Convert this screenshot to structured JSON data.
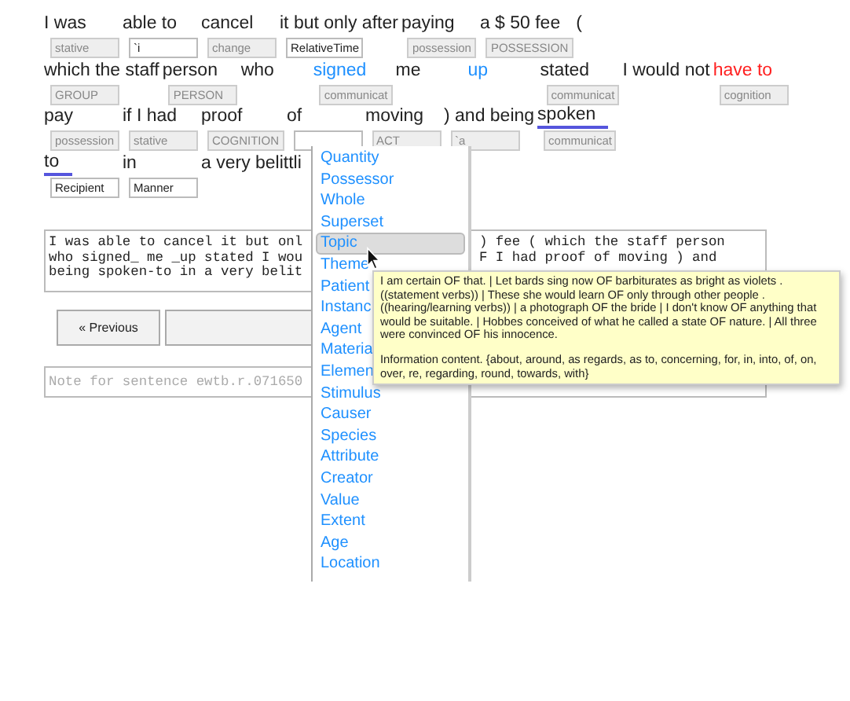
{
  "sentence_rows": [
    {
      "words": [
        {
          "text": "I was",
          "color": "#222222",
          "underlined": false,
          "tag": {
            "kind": "suggestion",
            "placeholder": "stative"
          }
        },
        {
          "text": "able to",
          "color": "#222222",
          "underlined": false,
          "tag": {
            "kind": "entered",
            "value": "`i"
          }
        },
        {
          "text": "cancel",
          "color": "#222222",
          "underlined": false,
          "tag": {
            "kind": "suggestion",
            "placeholder": "change"
          }
        },
        {
          "text": "it but only after",
          "color": "#222222",
          "underlined": false,
          "tag": {
            "kind": "entered",
            "value": "RelativeTime"
          }
        },
        {
          "text": "paying",
          "color": "#222222",
          "underlined": false,
          "tag": {
            "kind": "suggestion",
            "placeholder": "possession"
          }
        },
        {
          "text": "a $ 50 fee",
          "color": "#222222",
          "underlined": false,
          "tag": {
            "kind": "suggestion",
            "placeholder": "POSSESSION"
          }
        },
        {
          "text": "(",
          "color": "#222222",
          "underlined": false
        }
      ]
    },
    {
      "words": [
        {
          "text": "which the staff",
          "color": "#222222",
          "underlined": false,
          "tag": {
            "kind": "suggestion",
            "placeholder": "GROUP"
          }
        },
        {
          "text": "person",
          "color": "#222222",
          "underlined": false,
          "tag": {
            "kind": "suggestion",
            "placeholder": "PERSON"
          }
        },
        {
          "text": "who",
          "color": "#222222",
          "underlined": false
        },
        {
          "text": "signed",
          "color": "#1e90ff",
          "underlined": false,
          "tag": {
            "kind": "suggestion",
            "placeholder": "communicat"
          }
        },
        {
          "text": "me",
          "color": "#222222",
          "underlined": false
        },
        {
          "text": "up",
          "color": "#1e90ff",
          "underlined": false
        },
        {
          "text": "stated",
          "color": "#222222",
          "underlined": false,
          "tag": {
            "kind": "suggestion",
            "placeholder": "communicat"
          }
        },
        {
          "text": "I would not",
          "color": "#222222",
          "underlined": false
        },
        {
          "text": "have to",
          "color": "#ff2020",
          "underlined": false,
          "tag": {
            "kind": "suggestion",
            "placeholder": "cognition"
          }
        }
      ]
    },
    {
      "words": [
        {
          "text": "pay",
          "color": "#222222",
          "underlined": false,
          "tag": {
            "kind": "suggestion",
            "placeholder": "possession"
          }
        },
        {
          "text": "if I had",
          "color": "#222222",
          "underlined": false,
          "tag": {
            "kind": "suggestion",
            "placeholder": "stative"
          }
        },
        {
          "text": "proof",
          "color": "#222222",
          "underlined": false,
          "tag": {
            "kind": "suggestion",
            "placeholder": "COGNITION"
          }
        },
        {
          "text": "of",
          "color": "#222222",
          "underlined": false,
          "tag": {
            "kind": "entered"
          }
        },
        {
          "text": "moving",
          "color": "#222222",
          "underlined": false,
          "tag": {
            "kind": "suggestion",
            "placeholder": "ACT"
          }
        },
        {
          "text": ") and being",
          "color": "#222222",
          "underlined": false,
          "tag": {
            "kind": "suggestion",
            "placeholder": "`a"
          }
        },
        {
          "text": "spoken",
          "color": "#222222",
          "underlined": true,
          "tag": {
            "kind": "suggestion",
            "placeholder": "communicat"
          }
        }
      ]
    },
    {
      "words": [
        {
          "text": "to",
          "color": "#222222",
          "underlined": true,
          "tag": {
            "kind": "entered",
            "value": "Recipient"
          }
        },
        {
          "text": "in",
          "color": "#222222",
          "underlined": false,
          "tag": {
            "kind": "entered",
            "value": "Manner"
          }
        },
        {
          "text": "a very belittli",
          "color": "#222222",
          "underlined": false
        }
      ]
    }
  ],
  "sentence_box": {
    "left_lines": [
      "I was able to cancel it but onl",
      "who signed_ me _up stated I wou",
      "being spoken-to in a very belit"
    ],
    "right_lines": [
      ") fee ( which the staff person",
      "F I had proof of moving ) and"
    ]
  },
  "buttons": [
    {
      "label": "« Previous"
    }
  ],
  "note_field": {
    "placeholder": "Note for sentence ewtb.r.071650"
  },
  "role_menu": {
    "items": [
      {
        "label": "Quantity",
        "selected": false
      },
      {
        "label": "Possessor",
        "selected": false
      },
      {
        "label": "Whole",
        "selected": false
      },
      {
        "label": "Superset",
        "selected": false
      },
      {
        "label": "Topic",
        "selected": true
      },
      {
        "label": "Theme",
        "selected": false
      },
      {
        "label": "Patient",
        "selected": false
      },
      {
        "label": "Instanc",
        "selected": false
      },
      {
        "label": "Agent",
        "selected": false
      },
      {
        "label": "Materia",
        "selected": false
      },
      {
        "label": "Elemen",
        "selected": false
      },
      {
        "label": "Stimulus",
        "selected": false
      },
      {
        "label": "Causer",
        "selected": false
      },
      {
        "label": "Species",
        "selected": false
      },
      {
        "label": "Attribute",
        "selected": false
      },
      {
        "label": "Creator",
        "selected": false
      },
      {
        "label": "Value",
        "selected": false
      },
      {
        "label": "Extent",
        "selected": false
      },
      {
        "label": "Age",
        "selected": false
      },
      {
        "label": "Location",
        "selected": false
      }
    ]
  },
  "tooltip": {
    "examples": "I am certain OF that. | Let bards sing now OF barbiturates as bright as violets . ((statement verbs)) | These she would learn OF only through other people . ((hearing/learning verbs)) | a photograph OF the bride | I don't know OF anything that would be suitable. | Hobbes conceived of what he called a state OF nature. | All three were convinced OF his innocence.",
    "definition": "Information content. {about, around, as regards, as to, concerning, for, in, into, of, on, over, re, regarding, round, towards, with}"
  }
}
